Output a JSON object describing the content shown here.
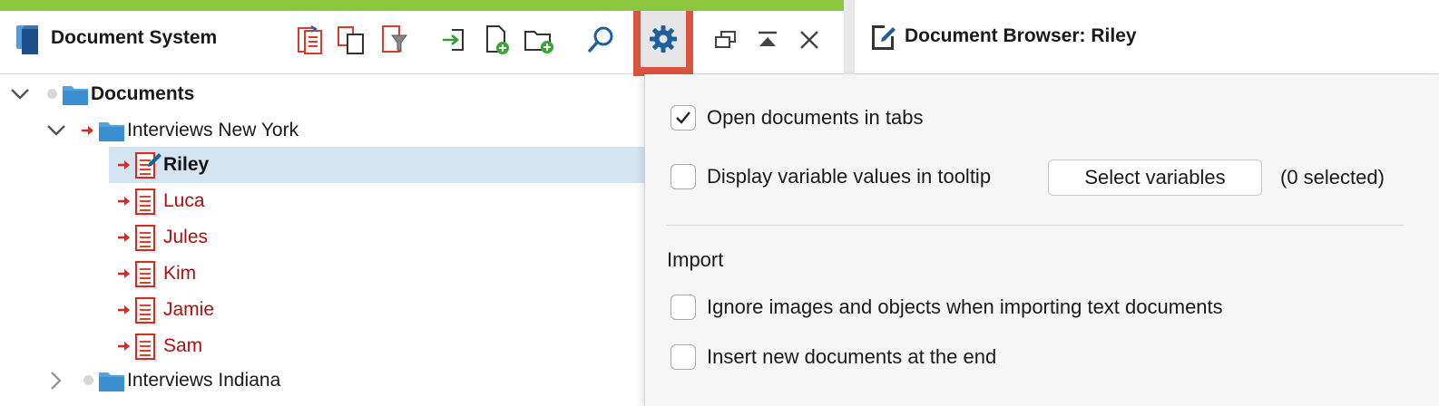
{
  "colors": {
    "accent_green": "#8cc63f",
    "highlight_red": "#d9553f",
    "selected_row": "#d4e4f2",
    "doc_red": "#b01010",
    "icon_blue": "#1f5f9e",
    "folder_blue": "#4fa3e0"
  },
  "left_panel": {
    "title": "Document System",
    "toolbar": {
      "buttons": [
        {
          "name": "retrieved-segments-icon"
        },
        {
          "name": "duplicate-documents-icon"
        },
        {
          "name": "filter-documents-icon"
        },
        {
          "name": "import-icon"
        },
        {
          "name": "new-document-icon"
        },
        {
          "name": "new-document-group-icon"
        },
        {
          "name": "search-icon"
        },
        {
          "name": "gear-icon"
        },
        {
          "name": "undock-window-icon"
        },
        {
          "name": "collapse-window-icon"
        },
        {
          "name": "close-icon"
        }
      ]
    }
  },
  "right_panel": {
    "title": "Document Browser: Riley"
  },
  "tree": {
    "root": "Documents",
    "groups": [
      {
        "label": "Interviews New York",
        "expanded": true,
        "documents": [
          {
            "label": "Riley",
            "selected": true
          },
          {
            "label": "Luca"
          },
          {
            "label": "Jules"
          },
          {
            "label": "Kim"
          },
          {
            "label": "Jamie"
          },
          {
            "label": "Sam"
          }
        ]
      },
      {
        "label": "Interviews Indiana",
        "expanded": false
      }
    ]
  },
  "options": {
    "open_in_tabs": {
      "label": "Open documents in tabs",
      "checked": true
    },
    "display_variables": {
      "label": "Display variable values in tooltip",
      "checked": false
    },
    "select_variables_button": "Select variables",
    "selected_count": "(0 selected)",
    "import_heading": "Import",
    "ignore_images": {
      "label": "Ignore images and objects when importing text documents",
      "checked": false
    },
    "insert_at_end": {
      "label": "Insert new documents at the end",
      "checked": false
    }
  }
}
